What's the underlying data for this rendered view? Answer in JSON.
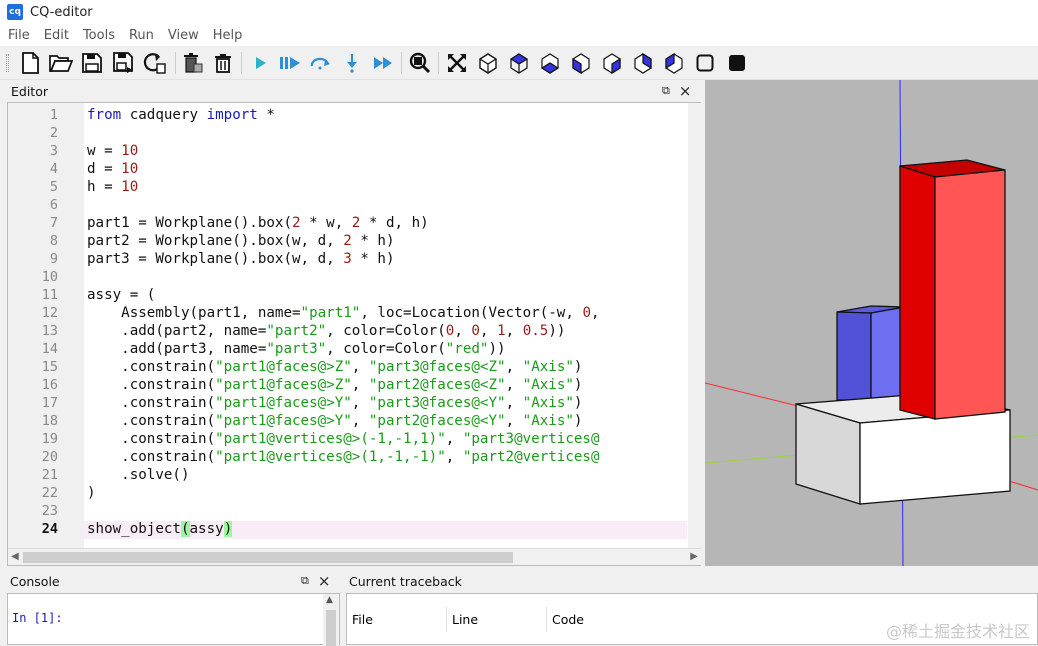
{
  "window": {
    "app_icon": "cq",
    "title": "CQ-editor"
  },
  "menu": [
    "File",
    "Edit",
    "Tools",
    "Run",
    "View",
    "Help"
  ],
  "toolbar": {
    "icons": [
      "new-file-icon",
      "open-folder-icon",
      "save-icon",
      "save-as-icon",
      "reload-icon",
      "clear-icon",
      "delete-icon",
      "run-icon",
      "debug-icon",
      "step-over-icon",
      "step-in-icon",
      "continue-icon",
      "zoom-fit-icon",
      "fit-all-icon",
      "iso-view-icon",
      "top-view-icon",
      "bottom-view-icon",
      "front-view-icon",
      "back-view-icon",
      "left-view-icon",
      "right-view-icon",
      "wireframe-icon",
      "shaded-icon"
    ],
    "accent": "#2f8fd6",
    "run_color": "#29b3c9"
  },
  "editor": {
    "title": "Editor",
    "float_icon": "⧉",
    "close_icon": "×",
    "line_numbers": [
      "1",
      "2",
      "3",
      "4",
      "5",
      "6",
      "7",
      "8",
      "9",
      "10",
      "11",
      "12",
      "13",
      "14",
      "15",
      "16",
      "17",
      "18",
      "19",
      "20",
      "21",
      "22",
      "23",
      "24"
    ],
    "current_line": "24",
    "lines": [
      "from cadquery import *",
      "",
      "w = 10",
      "d = 10",
      "h = 10",
      "",
      "part1 = Workplane().box(2 * w, 2 * d, h)",
      "part2 = Workplane().box(w, d, 2 * h)",
      "part3 = Workplane().box(w, d, 3 * h)",
      "",
      "assy = (",
      "    Assembly(part1, name=\"part1\", loc=Location(Vector(-w, 0,",
      "    .add(part2, name=\"part2\", color=Color(0, 0, 1, 0.5))",
      "    .add(part3, name=\"part3\", color=Color(\"red\"))",
      "    .constrain(\"part1@faces@>Z\", \"part3@faces@<Z\", \"Axis\")",
      "    .constrain(\"part1@faces@>Z\", \"part2@faces@<Z\", \"Axis\")",
      "    .constrain(\"part1@faces@>Y\", \"part3@faces@<Y\", \"Axis\")",
      "    .constrain(\"part1@faces@>Y\", \"part2@faces@<Y\", \"Axis\")",
      "    .constrain(\"part1@vertices@>(-1,-1,1)\", \"part3@vertices@",
      "    .constrain(\"part1@vertices@>(1,-1,-1)\", \"part2@vertices@",
      "    .solve()",
      ")",
      "",
      "show_object(assy)"
    ]
  },
  "viewer": {
    "background": "#b6b6b6",
    "red_part_color": "#ff5555",
    "blue_part_color": "#6e6ef0",
    "base_part_color": "#ffffff"
  },
  "console": {
    "title": "Console",
    "float_icon": "⧉",
    "close_icon": "×",
    "prompt": "In [1]:"
  },
  "traceback": {
    "title": "Current traceback",
    "columns": [
      "File",
      "Line",
      "Code"
    ]
  },
  "watermark": "@稀土掘金技术社区"
}
